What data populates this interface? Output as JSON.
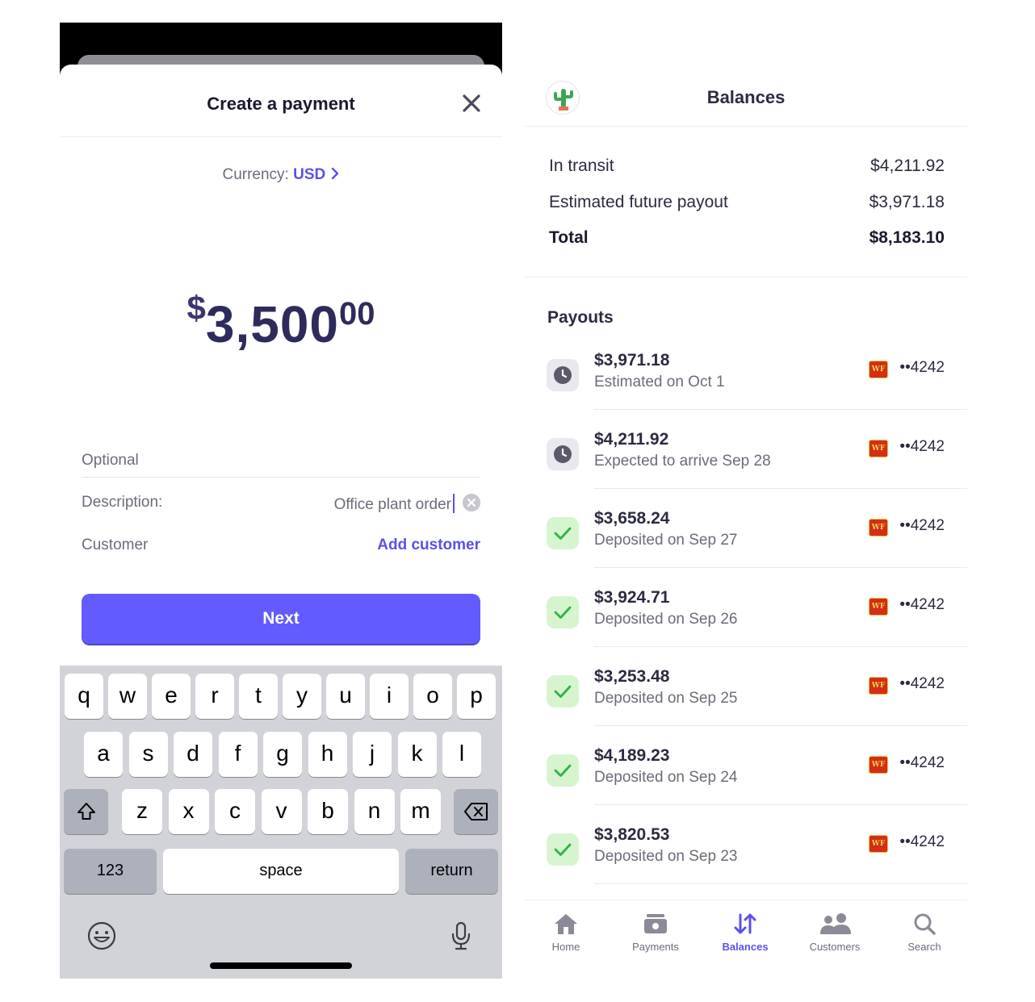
{
  "create_payment": {
    "title": "Create a payment",
    "currency_label": "Currency:",
    "currency_value": "USD",
    "amount": {
      "symbol": "$",
      "whole": "3,500",
      "cents": "00"
    },
    "optional_label": "Optional",
    "description_label": "Description:",
    "description_value": "Office plant order",
    "customer_label": "Customer",
    "add_customer": "Add customer",
    "next": "Next"
  },
  "keyboard": {
    "row1": [
      "q",
      "w",
      "e",
      "r",
      "t",
      "y",
      "u",
      "i",
      "o",
      "p"
    ],
    "row2": [
      "a",
      "s",
      "d",
      "f",
      "g",
      "h",
      "j",
      "k",
      "l"
    ],
    "row3": [
      "z",
      "x",
      "c",
      "v",
      "b",
      "n",
      "m"
    ],
    "numbers": "123",
    "space": "space",
    "return": "return"
  },
  "balances": {
    "title": "Balances",
    "rows": [
      {
        "label": "In transit",
        "value": "$4,211.92"
      },
      {
        "label": "Estimated future payout",
        "value": "$3,971.18"
      },
      {
        "label": "Total",
        "value": "$8,183.10"
      }
    ],
    "payouts_heading": "Payouts",
    "payouts": [
      {
        "amount": "$3,971.18",
        "status": "Estimated on Oct 1",
        "state": "pending",
        "bank": "WF",
        "account": "••4242"
      },
      {
        "amount": "$4,211.92",
        "status": "Expected to arrive Sep 28",
        "state": "pending",
        "bank": "WF",
        "account": "••4242"
      },
      {
        "amount": "$3,658.24",
        "status": "Deposited on Sep 27",
        "state": "done",
        "bank": "WF",
        "account": "••4242"
      },
      {
        "amount": "$3,924.71",
        "status": "Deposited on Sep 26",
        "state": "done",
        "bank": "WF",
        "account": "••4242"
      },
      {
        "amount": "$3,253.48",
        "status": "Deposited on Sep 25",
        "state": "done",
        "bank": "WF",
        "account": "••4242"
      },
      {
        "amount": "$4,189.23",
        "status": "Deposited on Sep 24",
        "state": "done",
        "bank": "WF",
        "account": "••4242"
      },
      {
        "amount": "$3,820.53",
        "status": "Deposited on Sep 23",
        "state": "done",
        "bank": "WF",
        "account": "••4242"
      }
    ],
    "tabs": [
      {
        "label": "Home",
        "icon": "home-icon"
      },
      {
        "label": "Payments",
        "icon": "payments-icon"
      },
      {
        "label": "Balances",
        "icon": "balances-icon",
        "active": true
      },
      {
        "label": "Customers",
        "icon": "customers-icon"
      },
      {
        "label": "Search",
        "icon": "search-icon"
      }
    ]
  },
  "colors": {
    "accent": "#635bff",
    "success": "#2fb344",
    "success_bg": "#d6f5cf",
    "bank_red": "#d42d1a"
  }
}
